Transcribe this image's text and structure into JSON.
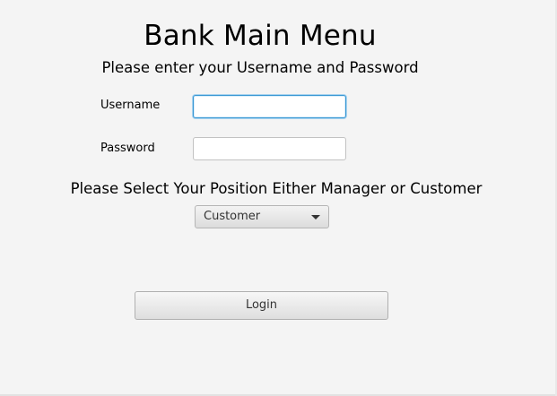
{
  "header": {
    "title": "Bank Main Menu",
    "subtitle": "Please enter your Username and Password"
  },
  "form": {
    "username_label": "Username",
    "username_value": "",
    "username_placeholder": "",
    "password_label": "Password",
    "password_value": "",
    "password_placeholder": "",
    "position_prompt": "Please Select Your Position Either Manager or Customer",
    "position_selected": "Customer",
    "login_label": "Login"
  },
  "colors": {
    "background": "#f4f4f4",
    "focus_border": "#3a98d4"
  }
}
